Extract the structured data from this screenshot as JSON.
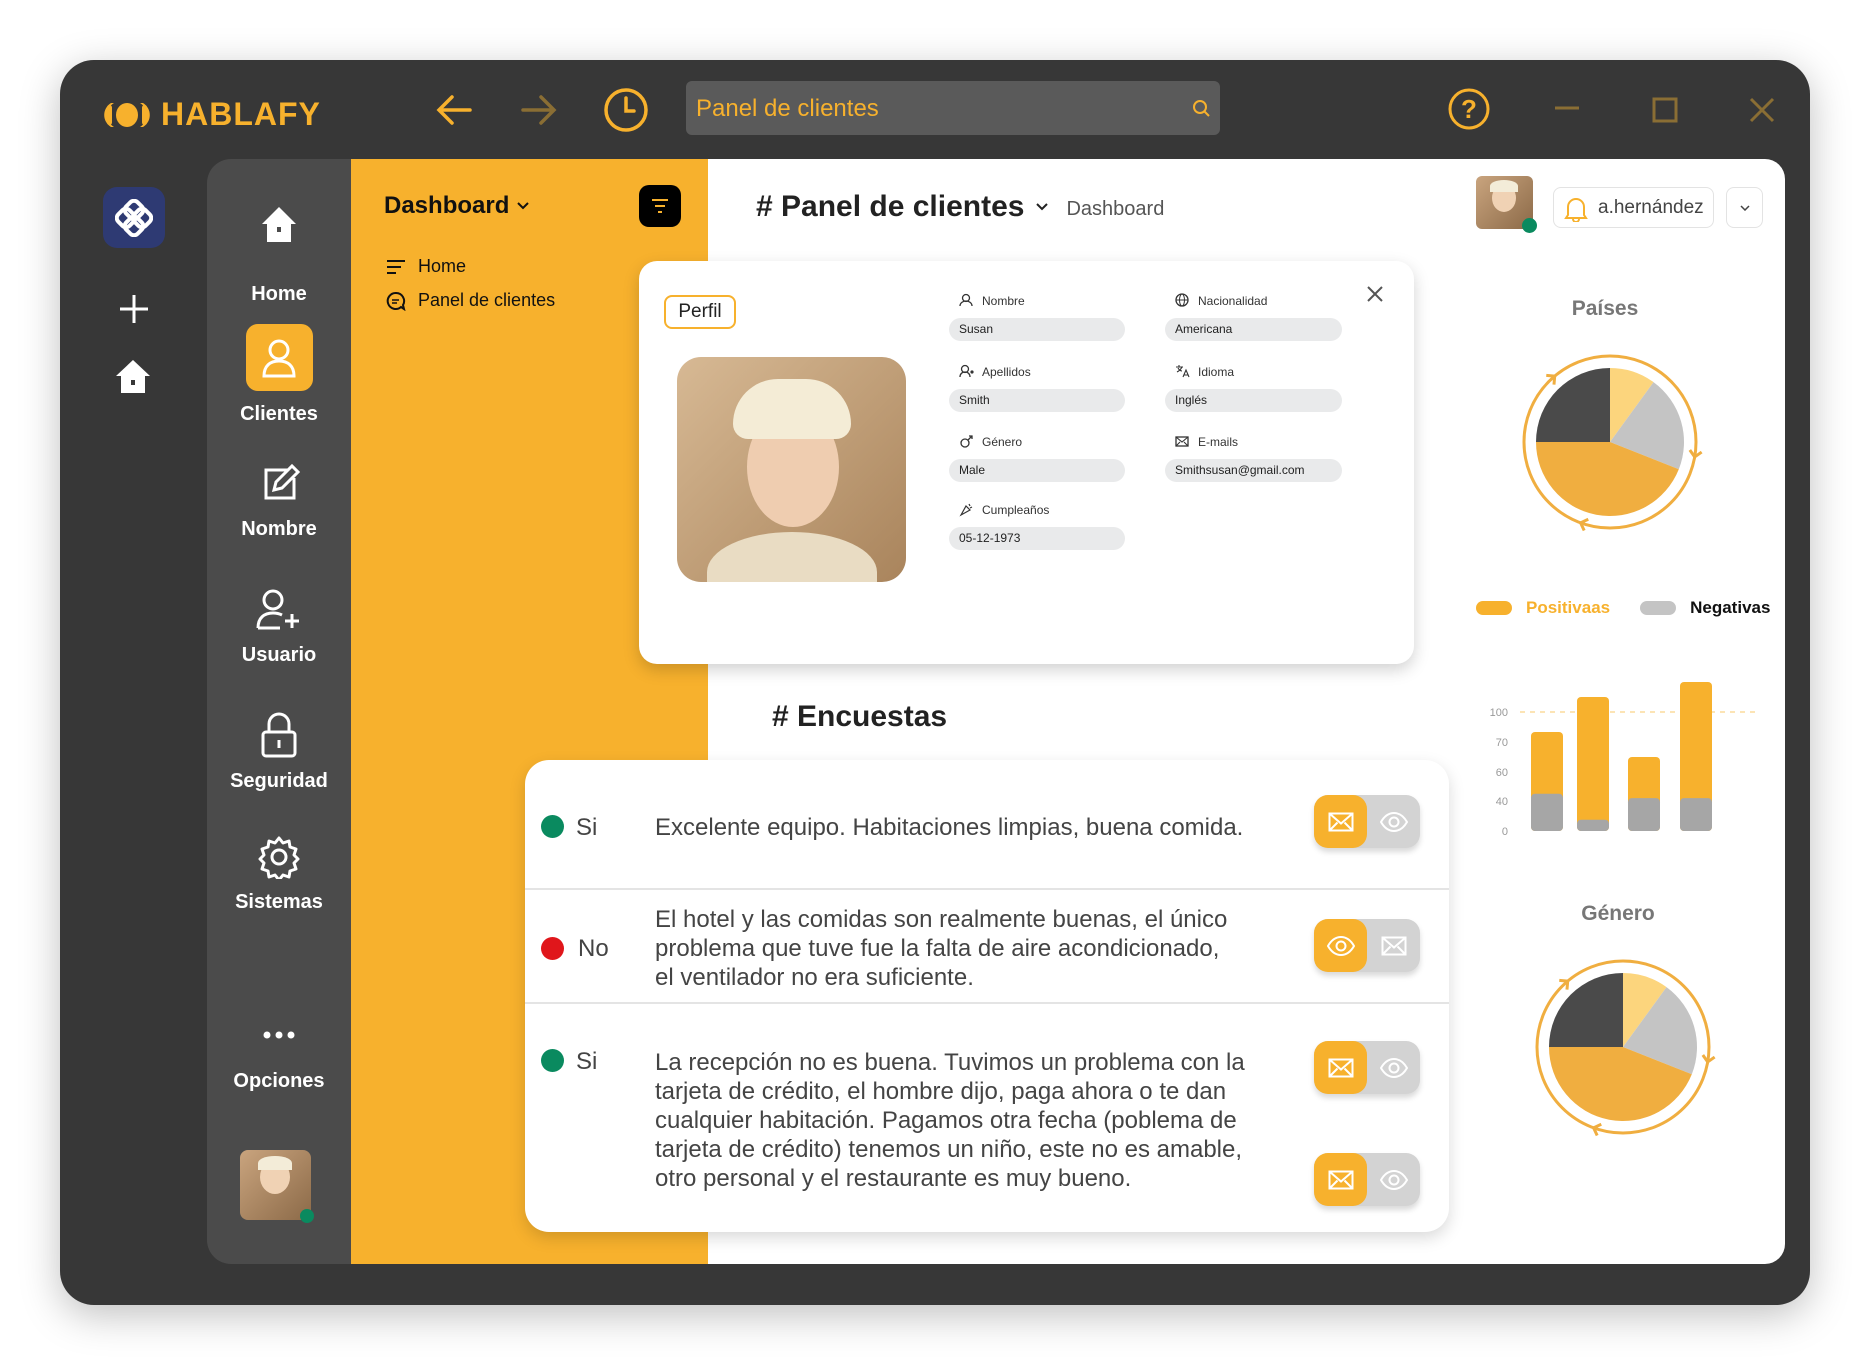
{
  "app": {
    "name": "HABLAFY",
    "search_value": "Panel de clientes"
  },
  "colors": {
    "accent": "#F7B12D",
    "dark": "#373737",
    "sidebar": "#4B4B4B",
    "positive": "#0A8A5F",
    "negative": "#E0161B"
  },
  "rail": {
    "icons": [
      "workspace-logo-icon",
      "plus-icon",
      "home-icon"
    ]
  },
  "sidebar": {
    "items": [
      {
        "label": "Home",
        "icon": "home-icon"
      },
      {
        "label": "Clientes",
        "icon": "user-icon",
        "active": true
      },
      {
        "label": "Nombre",
        "icon": "edit-icon"
      },
      {
        "label": "Usuario",
        "icon": "add-user-icon"
      },
      {
        "label": "Seguridad",
        "icon": "lock-icon"
      },
      {
        "label": "Sistemas",
        "icon": "gear-icon"
      },
      {
        "label": "Opciones",
        "icon": "more-icon"
      }
    ]
  },
  "panel": {
    "title": "Dashboard",
    "items": [
      {
        "label": "Home"
      },
      {
        "label": "Panel de clientes"
      }
    ]
  },
  "header": {
    "title": "# Panel de clientes",
    "breadcrumb": "Dashboard",
    "username": "a.hernández"
  },
  "profile": {
    "tab": "Perfil",
    "fields": [
      {
        "label": "Nombre",
        "value": "Susan",
        "icon": "user-icon"
      },
      {
        "label": "Apellidos",
        "value": "Smith",
        "icon": "users-icon"
      },
      {
        "label": "Género",
        "value": "Male",
        "icon": "male-icon"
      },
      {
        "label": "Cumpleaños",
        "value": "05-12-1973",
        "icon": "party-icon"
      },
      {
        "label": "Nacionalidad",
        "value": "Americana",
        "icon": "globe-icon"
      },
      {
        "label": "Idioma",
        "value": "Inglés",
        "icon": "translate-icon"
      },
      {
        "label": "E-mails",
        "value": "Smithsusan@gmail.com",
        "icon": "mail-icon"
      }
    ]
  },
  "surveys": {
    "title": "# Encuestas",
    "rows": [
      {
        "answer": "Si",
        "status": "positive",
        "lines": [
          "Excelente equipo. Habitaciones limpias, buena comida."
        ]
      },
      {
        "answer": "No",
        "status": "negative",
        "lines": [
          "El hotel y las comidas son realmente buenas, el único",
          "problema que tuve fue la falta de aire acondicionado,",
          "el ventilador no era suficiente."
        ]
      },
      {
        "answer": "Si",
        "status": "positive",
        "lines": [
          "La recepción no es buena. Tuvimos un problema con la",
          "tarjeta de crédito, el hombre dijo, paga ahora o te dan",
          "cualquier habitación. Pagamos otra fecha (poblema de",
          "tarjeta de crédito) tenemos un niño, este no es amable,",
          "otro personal y el restaurante es muy bueno."
        ]
      }
    ]
  },
  "chart_data": [
    {
      "type": "pie",
      "title": "Países",
      "values": [
        10,
        21,
        44,
        25
      ],
      "colors": [
        "#FCD57D",
        "#C4C4C4",
        "#F0AE40",
        "#4A4A4A"
      ]
    },
    {
      "type": "bar",
      "stacked": true,
      "legend": "top",
      "series": [
        {
          "name": "Positivaas",
          "color": "#F7B12D",
          "values": [
            80,
            115,
            65,
            130
          ]
        },
        {
          "name": "Negativas",
          "color": "#A6A6A6",
          "values": [
            45,
            15,
            42,
            42
          ]
        }
      ],
      "y_ticks": [
        0,
        40,
        60,
        70,
        100
      ],
      "reference_line": 100
    },
    {
      "type": "pie",
      "title": "Género",
      "values": [
        10,
        21,
        44,
        25
      ],
      "colors": [
        "#FCD57D",
        "#C4C4C4",
        "#F0AE40",
        "#4A4A4A"
      ]
    }
  ]
}
